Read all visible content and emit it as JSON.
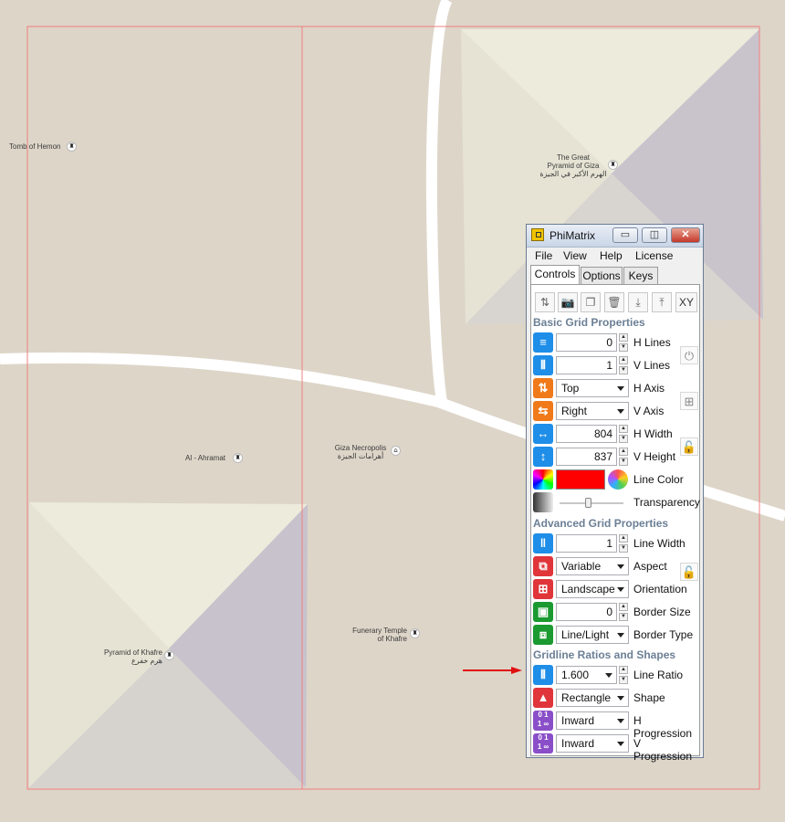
{
  "map": {
    "labels": {
      "tomb_of_hemon": "Tomb of Hemon",
      "great_pyramid_en": "The Great",
      "great_pyramid_en2": "Pyramid of Giza",
      "great_pyramid_ar": "الهرم الأكبر في الجيزة",
      "al_ahramat": "Al - Ahramat",
      "giza_necropolis_en": "Giza Necropolis",
      "giza_necropolis_ar": "أهرامات الجيزة",
      "funerary_temple_1": "Funerary Temple",
      "funerary_temple_2": "of Khafre",
      "pyramid_khafre_en": "Pyramid of Khafre",
      "pyramid_khafre_ar": "هرم خفرع"
    },
    "grid_line_color": "#f08080"
  },
  "window": {
    "title": "PhiMatrix",
    "minimize_glyph": "▭",
    "restore_glyph": "◫",
    "close_glyph": "✕",
    "menu": [
      "File",
      "View",
      "Help",
      "License"
    ],
    "tabs": [
      "Controls",
      "Options",
      "Keys"
    ],
    "toolbar": {
      "sort_glyph": "⇅",
      "camera_glyph": "📷",
      "copy_glyph": "❐",
      "trash_glyph": "🗑",
      "import_glyph": "⤓",
      "export_glyph": "⤒",
      "xy_label": "XY"
    }
  },
  "basic": {
    "title": "Basic Grid Properties",
    "h_lines": {
      "value": "0",
      "label": "H Lines"
    },
    "v_lines": {
      "value": "1",
      "label": "V Lines"
    },
    "h_axis": {
      "value": "Top",
      "label": "H Axis"
    },
    "v_axis": {
      "value": "Right",
      "label": "V Axis"
    },
    "h_width": {
      "value": "804",
      "label": "H Width"
    },
    "v_height": {
      "value": "837",
      "label": "V Height"
    },
    "line_color": {
      "value": "#ff0000",
      "label": "Line Color"
    },
    "transparency": {
      "label": "Transparency",
      "level": 0.45
    },
    "power_glyph": "⏻",
    "grid_glyph": "⊞",
    "lock_glyph": "🔓"
  },
  "advanced": {
    "title": "Advanced Grid Properties",
    "line_width": {
      "value": "1",
      "label": "Line Width"
    },
    "aspect": {
      "value": "Variable",
      "label": "Aspect"
    },
    "orientation": {
      "value": "Landscape",
      "label": "Orientation"
    },
    "border_size": {
      "value": "0",
      "label": "Border Size"
    },
    "border_type": {
      "value": "Line/Light",
      "label": "Border Type"
    },
    "lock_glyph": "🔓"
  },
  "ratios": {
    "title": "Gridline Ratios and Shapes",
    "line_ratio": {
      "value": "1.600",
      "label": "Line Ratio"
    },
    "shape": {
      "value": "Rectangle",
      "label": "Shape"
    },
    "h_progression": {
      "value": "Inward",
      "label": "H Progression"
    },
    "v_progression": {
      "value": "Inward",
      "label": "V Progression"
    }
  },
  "colors": {
    "accent_blue": "#1e8ee8",
    "accent_orange": "#f07a1a",
    "accent_red": "#e0353a",
    "accent_green": "#1a9a30",
    "accent_purple": "#8a4fc8",
    "arrow_red": "#e01010"
  }
}
